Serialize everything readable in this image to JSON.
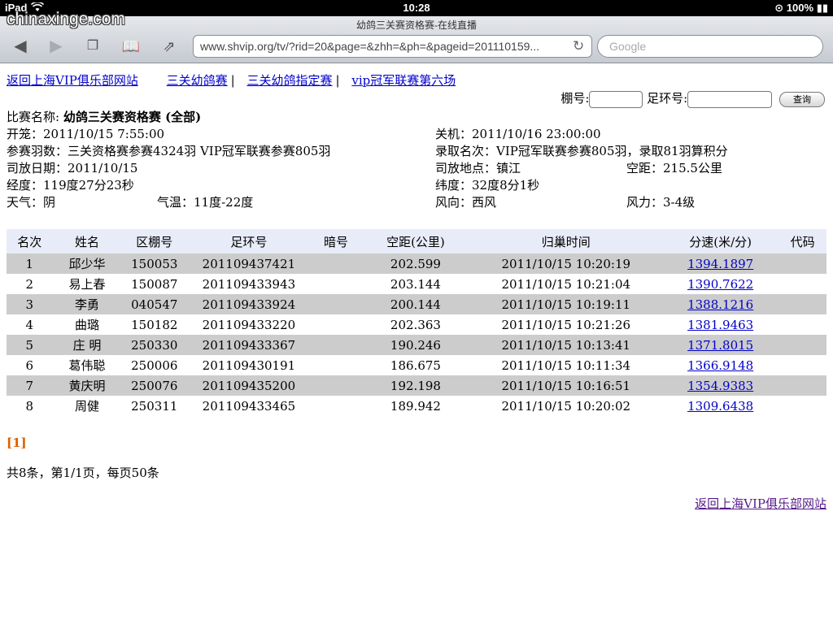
{
  "status": {
    "device": "iPad",
    "time": "10:28",
    "battery": "100%"
  },
  "watermark": "chinaxinge.com",
  "browser": {
    "title": "幼鸽三关赛资格赛-在线直播",
    "url": "www.shvip.org/tv/?rid=20&page=&zhh=&ph=&pageid=201110159...",
    "search_placeholder": "Google",
    "tabs_count": "2"
  },
  "links": {
    "back_home": "返回上海VIP俱乐部网站",
    "race1": "三关幼鸽赛",
    "race2": "三关幼鸽指定赛",
    "race3": "vip冠军联赛第六场",
    "sep": "|"
  },
  "search": {
    "loft_label": "棚号:",
    "ring_label": "足环号:",
    "button": "查询"
  },
  "info": {
    "race_name_label": "比赛名称:",
    "race_name": "幼鸽三关赛资格赛 (全部)",
    "basketing": "开笼：2011/10/15 7:55:00",
    "close": "关机：2011/10/16 23:00:00",
    "entries": "参赛羽数：三关资格赛参赛4324羽 VIP冠军联赛参赛805羽",
    "placings": "录取名次：VIP冠军联赛参赛805羽，录取81羽算积分",
    "release_date": "司放日期：2011/10/15",
    "release_place": "司放地点：镇江",
    "distance": "空距：215.5公里",
    "longitude": "经度：119度27分23秒",
    "latitude": "纬度：32度8分1秒",
    "weather": "天气：阴",
    "temperature": "气温：11度-22度",
    "wind_dir": "风向：西风",
    "wind_force": "风力：3-4级"
  },
  "table": {
    "headers": [
      "名次",
      "姓名",
      "区棚号",
      "足环号",
      "暗号",
      "空距(公里)",
      "归巢时间",
      "分速(米/分)",
      "代码"
    ],
    "rows": [
      [
        "1",
        "邱少华",
        "150053",
        "201109437421",
        "",
        "202.599",
        "2011/10/15 10:20:19",
        "1394.1897",
        ""
      ],
      [
        "2",
        "易上春",
        "150087",
        "201109433943",
        "",
        "203.144",
        "2011/10/15 10:21:04",
        "1390.7622",
        ""
      ],
      [
        "3",
        "李勇",
        "040547",
        "201109433924",
        "",
        "200.144",
        "2011/10/15 10:19:11",
        "1388.1216",
        ""
      ],
      [
        "4",
        "曲璐",
        "150182",
        "201109433220",
        "",
        "202.363",
        "2011/10/15 10:21:26",
        "1381.9463",
        ""
      ],
      [
        "5",
        "庄 明",
        "250330",
        "201109433367",
        "",
        "190.246",
        "2011/10/15 10:13:41",
        "1371.8015",
        ""
      ],
      [
        "6",
        "葛伟聪",
        "250006",
        "201109430191",
        "",
        "186.675",
        "2011/10/15 10:11:34",
        "1366.9148",
        ""
      ],
      [
        "7",
        "黄庆明",
        "250076",
        "201109435200",
        "",
        "192.198",
        "2011/10/15 10:16:51",
        "1354.9383",
        ""
      ],
      [
        "8",
        "周健",
        "250311",
        "201109433465",
        "",
        "189.942",
        "2011/10/15 10:20:02",
        "1309.6438",
        ""
      ]
    ]
  },
  "pager": "[1]",
  "total": "共8条，第1/1页，每页50条",
  "footer_link": "返回上海VIP俱乐部网站"
}
